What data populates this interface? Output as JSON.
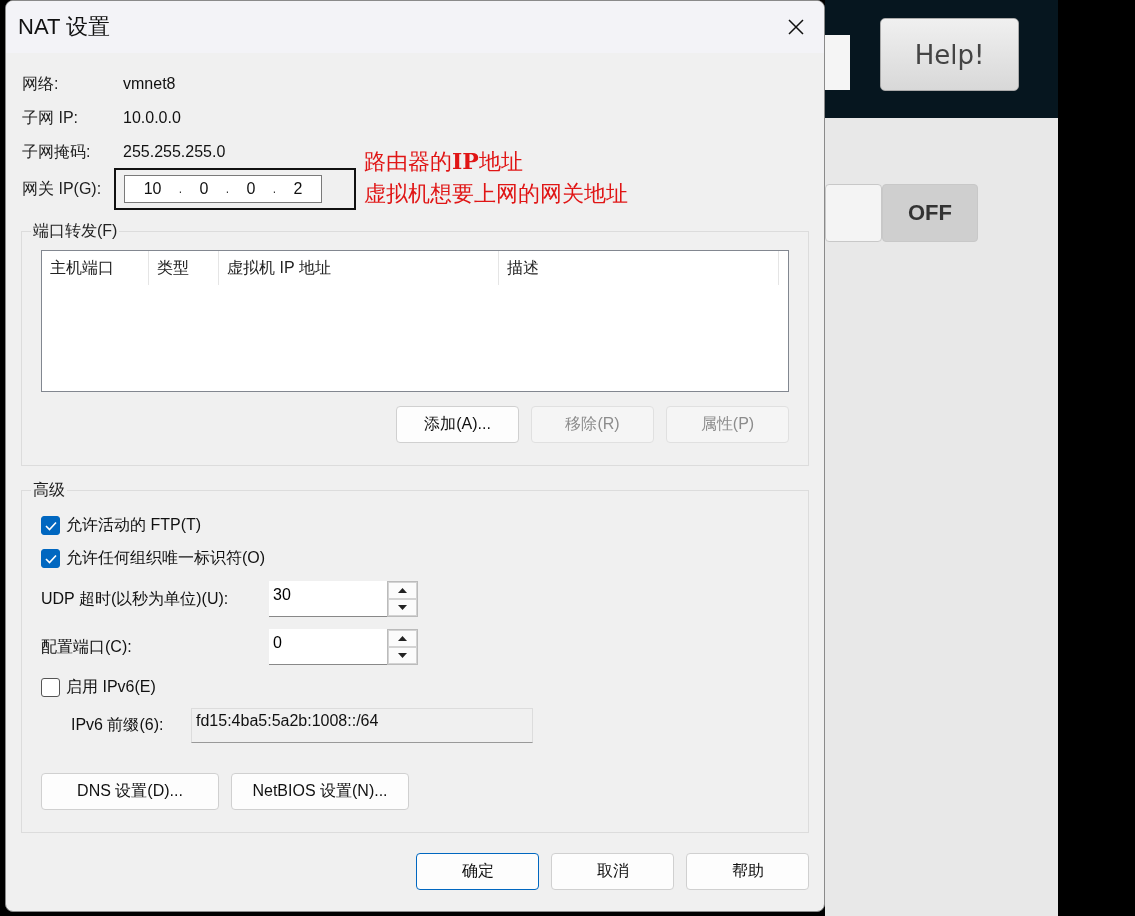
{
  "dialog": {
    "title": "NAT 设置",
    "info": [
      {
        "label": "网络:",
        "value": "vmnet8"
      },
      {
        "label": "子网 IP:",
        "value": "10.0.0.0"
      },
      {
        "label": "子网掩码:",
        "value": "255.255.255.0"
      }
    ],
    "gateway": {
      "label": "网关 IP(G):",
      "octets": [
        "10",
        "0",
        "0",
        "2"
      ],
      "separator": "."
    },
    "port_forwarding": {
      "title": "端口转发(F)",
      "columns": [
        "主机端口",
        "类型",
        "虚拟机 IP 地址",
        "描述"
      ],
      "buttons": [
        {
          "label": "添加(A)...",
          "disabled": false
        },
        {
          "label": "移除(R)",
          "disabled": true
        },
        {
          "label": "属性(P)",
          "disabled": true
        }
      ]
    },
    "advanced": {
      "title": "高级",
      "items": [
        {
          "kind": "checkbox",
          "label": "允许活动的 FTP(T)",
          "checked": true
        },
        {
          "kind": "checkbox",
          "label": "允许任何组织唯一标识符(O)",
          "checked": true
        },
        {
          "kind": "spinner",
          "label": "UDP 超时(以秒为单位)(U):",
          "value": "30"
        },
        {
          "kind": "spinner",
          "label": "配置端口(C):",
          "value": "0"
        },
        {
          "kind": "checkbox",
          "label": "启用 IPv6(E)",
          "checked": false
        },
        {
          "kind": "readonly",
          "label": "IPv6 前缀(6):",
          "value": "fd15:4ba5:5a2b:1008::/64"
        }
      ],
      "buttons": [
        "DNS 设置(D)...",
        "NetBIOS 设置(N)..."
      ]
    },
    "footer_buttons": [
      {
        "label": "确定",
        "default": true
      },
      {
        "label": "取消",
        "default": false
      },
      {
        "label": "帮助",
        "default": false
      }
    ]
  },
  "annotation": {
    "lines": [
      "路由器的**IP**地址",
      "虚拟机想要上网的网关地址"
    ]
  },
  "background": {
    "help_button": "Help!",
    "toggle": {
      "label": "OFF",
      "on": false
    }
  }
}
